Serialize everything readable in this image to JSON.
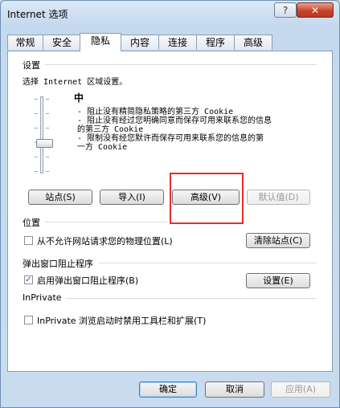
{
  "window": {
    "title": "Internet 选项",
    "help_label": "?",
    "close_label": "✕"
  },
  "tabs": [
    {
      "label": "常规"
    },
    {
      "label": "安全"
    },
    {
      "label": "隐私"
    },
    {
      "label": "内容"
    },
    {
      "label": "连接"
    },
    {
      "label": "程序"
    },
    {
      "label": "高级"
    }
  ],
  "settings": {
    "section_label": "设置",
    "instruction": "选择 Internet 区域设置。",
    "level": "中",
    "slider_level_index": 2,
    "slider_level_count": 6,
    "description_lines": [
      "- 阻止没有精简隐私策略的第三方 Cookie",
      "- 阻止没有经过您明确同意而保存可用来联系您的信息",
      "的第三方 Cookie",
      "- 限制没有经您默许而保存可用来联系您的信息的第",
      "一方 Cookie"
    ],
    "buttons": {
      "sites": "站点(S)",
      "import": "导入(I)",
      "advanced": "高级(V)",
      "default": "默认值(D)"
    }
  },
  "location": {
    "section_label": "位置",
    "checkbox_label": "从不允许网站请求您的物理位置(L)",
    "checked": false,
    "clear_button": "清除站点(C)"
  },
  "popup": {
    "section_label": "弹出窗口阻止程序",
    "checkbox_label": "启用弹出窗口阻止程序(B)",
    "checked": true,
    "check_mark": "✓",
    "settings_button": "设置(E)"
  },
  "inprivate": {
    "section_label": "InPrivate",
    "checkbox_label": "InPrivate 浏览启动时禁用工具栏和扩展(T)",
    "checked": false
  },
  "dialog_buttons": {
    "ok": "确定",
    "cancel": "取消",
    "apply": "应用(A)"
  },
  "colors": {
    "highlight_box": "#e0302d",
    "close_button": "#c9442a"
  }
}
